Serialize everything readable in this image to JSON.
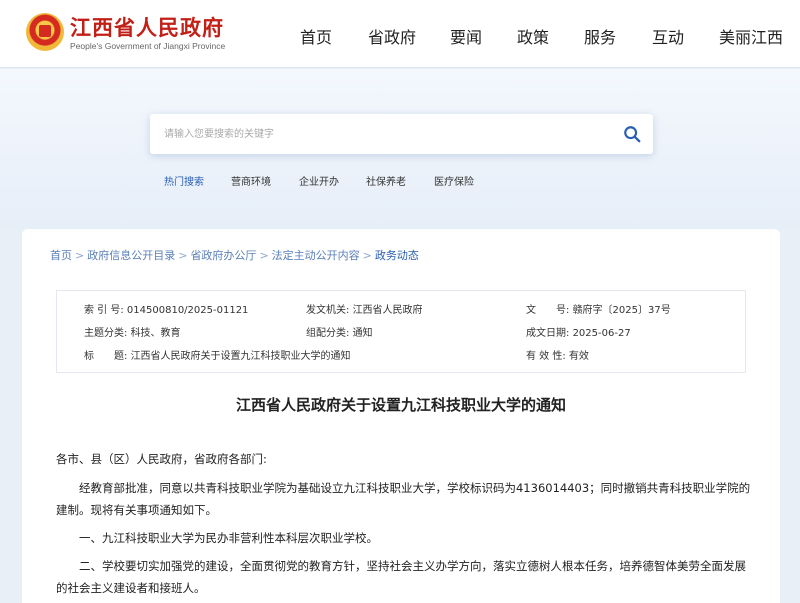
{
  "header": {
    "site_title": "江西省人民政府",
    "site_subtitle": "People's Government of Jiangxi Province",
    "nav": [
      "首页",
      "省政府",
      "要闻",
      "政策",
      "服务",
      "互动",
      "美丽江西"
    ]
  },
  "search": {
    "placeholder": "请输入您要搜索的关键字",
    "hot_label": "热门搜索",
    "hot_terms": [
      "营商环境",
      "企业开办",
      "社保养老",
      "医疗保险"
    ]
  },
  "breadcrumb": [
    "首页",
    "政府信息公开目录",
    "省政府办公厅",
    "法定主动公开内容",
    "政务动态"
  ],
  "meta": {
    "index_label": "索 引 号:",
    "index_value": "014500810/2025-01121",
    "issuer_label": "发文机关:",
    "issuer_value": "江西省人民政府",
    "docno_label": "文　　号:",
    "docno_value": "赣府字〔2025〕37号",
    "topic_label": "主题分类:",
    "topic_value": "科技、教育",
    "genre_label": "组配分类:",
    "genre_value": "通知",
    "date_label": "成文日期:",
    "date_value": "2025-06-27",
    "title_label": "标　　题:",
    "title_value": "江西省人民政府关于设置九江科技职业大学的通知",
    "valid_label": "有 效 性:",
    "valid_value": "有效"
  },
  "document": {
    "title": "江西省人民政府关于设置九江科技职业大学的通知",
    "salutation": "各市、县（区）人民政府，省政府各部门:",
    "p1": "经教育部批准，同意以共青科技职业学院为基础设立九江科技职业大学，学校标识码为4136014403；同时撤销共青科技职业学院的建制。现将有关事项通知如下。",
    "p2": "一、九江科技职业大学为民办非营利性本科层次职业学校。",
    "p3": "二、学校要切实加强党的建设，全面贯彻党的教育方针，坚持社会主义办学方向，落实立德树人根本任务，培养德智体美劳全面发展的社会主义建设者和接班人。"
  },
  "colors": {
    "brand_red": "#c21f17",
    "link_blue": "#2a5fb3"
  }
}
